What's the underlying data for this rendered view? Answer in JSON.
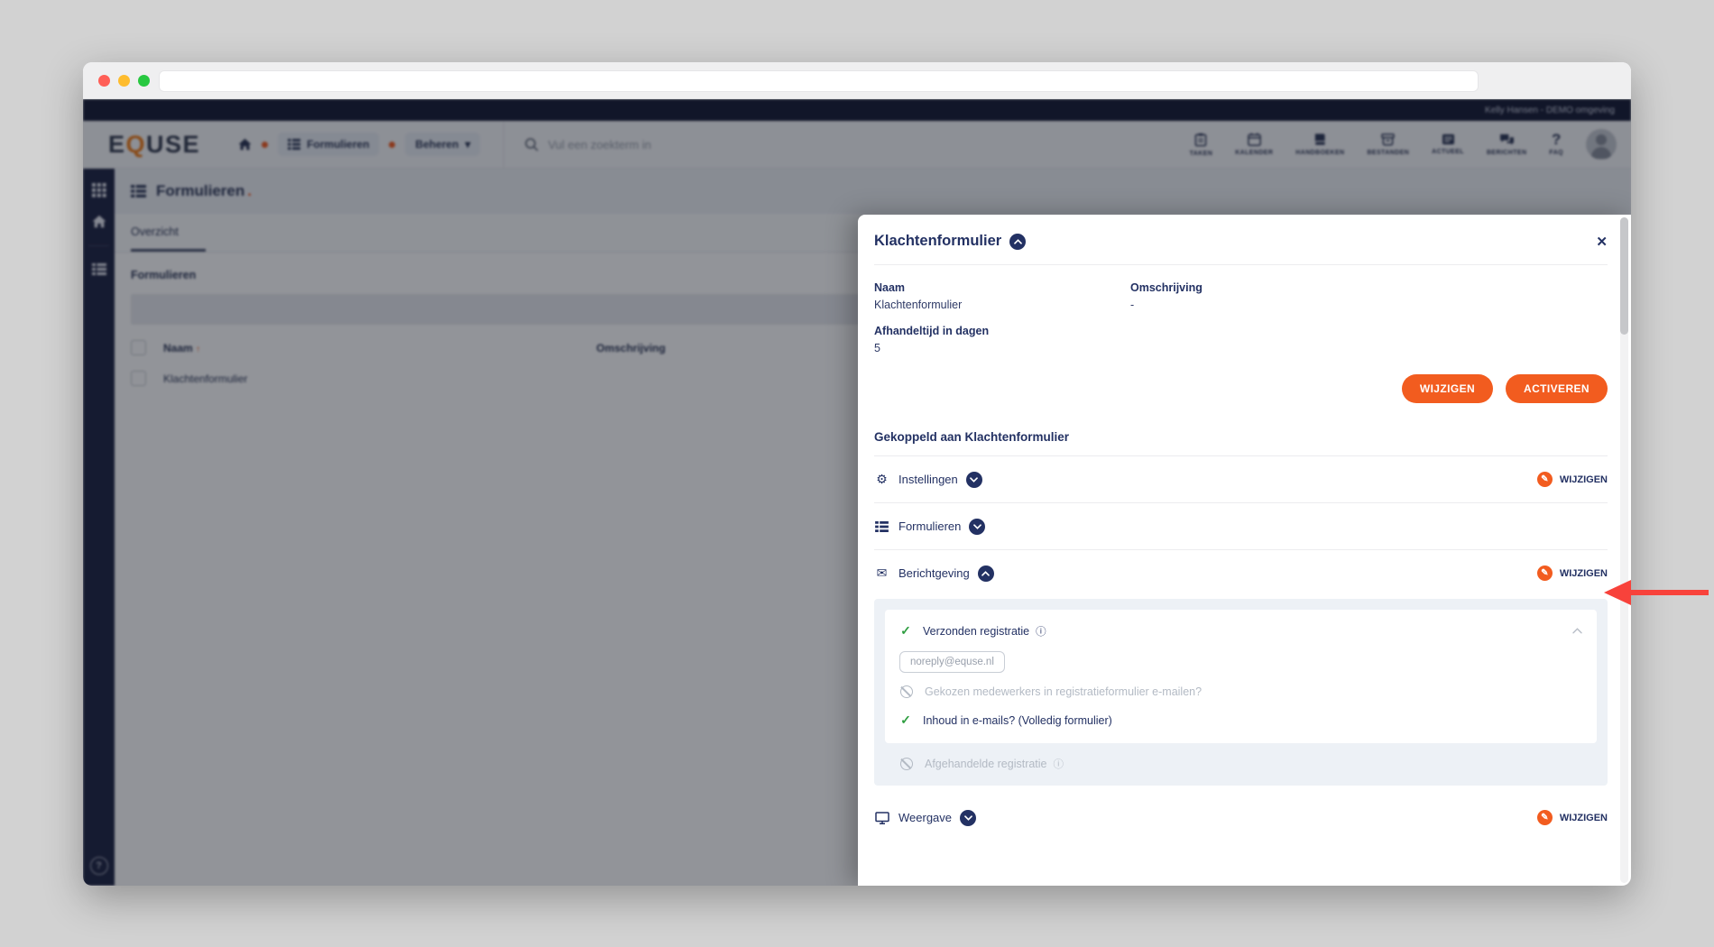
{
  "colors": {
    "accent_orange": "#f25c1f",
    "navy_text": "#233163",
    "green_check": "#2f9e41",
    "disabled_gray": "#b3bac4",
    "arrow_red": "#f8423b",
    "sidebar_navy": "#1d2342"
  },
  "icons": {
    "gear": "⚙",
    "mail": "✉",
    "pencil": "✎",
    "check": "✓",
    "info": "ⓘ",
    "close": "✕",
    "caret_down": "▾",
    "sort_up": "↑",
    "question": "?",
    "help": "?"
  },
  "browser": {
    "url_text": ""
  },
  "background": {
    "user_session": "Kelly Hansen - DEMO omgeving",
    "logo": {
      "pre": "E",
      "q": "Q",
      "post": "USE"
    },
    "breadcrumb": {
      "item1": "Formulieren",
      "item2": "Beheren"
    },
    "search_placeholder": "Vul een zoekterm in",
    "nav": [
      {
        "label": "TAKEN"
      },
      {
        "label": "KALENDER"
      },
      {
        "label": "HANDBOEKEN"
      },
      {
        "label": "BESTANDEN"
      },
      {
        "label": "ACTUEEL"
      },
      {
        "label": "BERICHTEN"
      },
      {
        "label": "FAQ"
      }
    ],
    "page": {
      "title": "Formulieren",
      "title_dot": ".",
      "tab": "Overzicht",
      "section": "Formulieren",
      "col_naam": "Naam",
      "col_omschrijving": "Omschrijving",
      "row1_naam": "Klachtenformulier"
    }
  },
  "modal": {
    "title": "Klachtenformulier",
    "fields": {
      "naam_label": "Naam",
      "naam_value": "Klachtenformulier",
      "omschrijving_label": "Omschrijving",
      "omschrijving_value": "-",
      "afhandeltijd_label": "Afhandeltijd in dagen",
      "afhandeltijd_value": "5"
    },
    "buttons": {
      "wijzigen": "WIJZIGEN",
      "activeren": "ACTIVEREN"
    },
    "linked_heading": "Gekoppeld aan Klachtenformulier",
    "edit_label": "WIJZIGEN",
    "sections": {
      "instellingen": "Instellingen",
      "formulieren": "Formulieren",
      "berichtgeving": "Berichtgeving",
      "weergave": "Weergave"
    },
    "berichtgeving_detail": {
      "verzonden_label": "Verzonden registratie",
      "email_chip": "noreply@equse.nl",
      "medewerkers_label": "Gekozen medewerkers in registratieformulier e-mailen?",
      "inhoud_label": "Inhoud in e-mails? (Volledig formulier)",
      "afgehandeld_label": "Afgehandelde registratie"
    }
  }
}
